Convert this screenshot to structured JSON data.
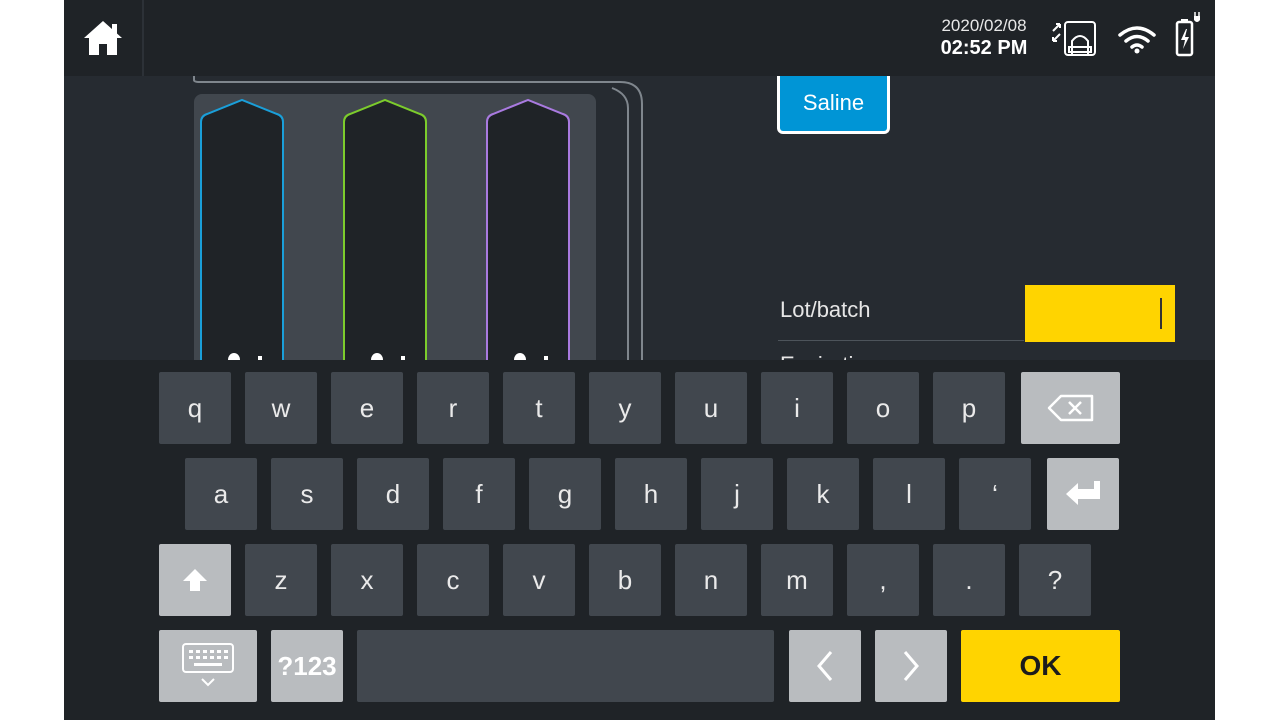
{
  "status_bar": {
    "date": "2020/02/08",
    "time": "02:52 PM",
    "icons": [
      "home-icon",
      "screen-expand-icon",
      "wifi-icon",
      "battery-charging-icon"
    ]
  },
  "content": {
    "saline_button_label": "Saline",
    "lot_label": "Lot/batch",
    "lot_value": "",
    "expiration_label": "Expiration",
    "syringe_colors": [
      "#1a9fd9",
      "#7ccc2c",
      "#a97ae0"
    ]
  },
  "keyboard": {
    "row1": [
      "q",
      "w",
      "e",
      "r",
      "t",
      "y",
      "u",
      "i",
      "o",
      "p"
    ],
    "row2": [
      "a",
      "s",
      "d",
      "f",
      "g",
      "h",
      "j",
      "k",
      "l",
      "‘"
    ],
    "row3": [
      "z",
      "x",
      "c",
      "v",
      "b",
      "n",
      "m",
      ",",
      ".",
      "?"
    ],
    "symbols_label": "?123",
    "ok_label": "OK",
    "icons": [
      "backspace-icon",
      "enter-icon",
      "shift-icon",
      "hide-keyboard-icon",
      "chevron-left-icon",
      "chevron-right-icon"
    ]
  },
  "colors": {
    "accent_yellow": "#ffd400",
    "accent_blue": "#0095d6"
  }
}
